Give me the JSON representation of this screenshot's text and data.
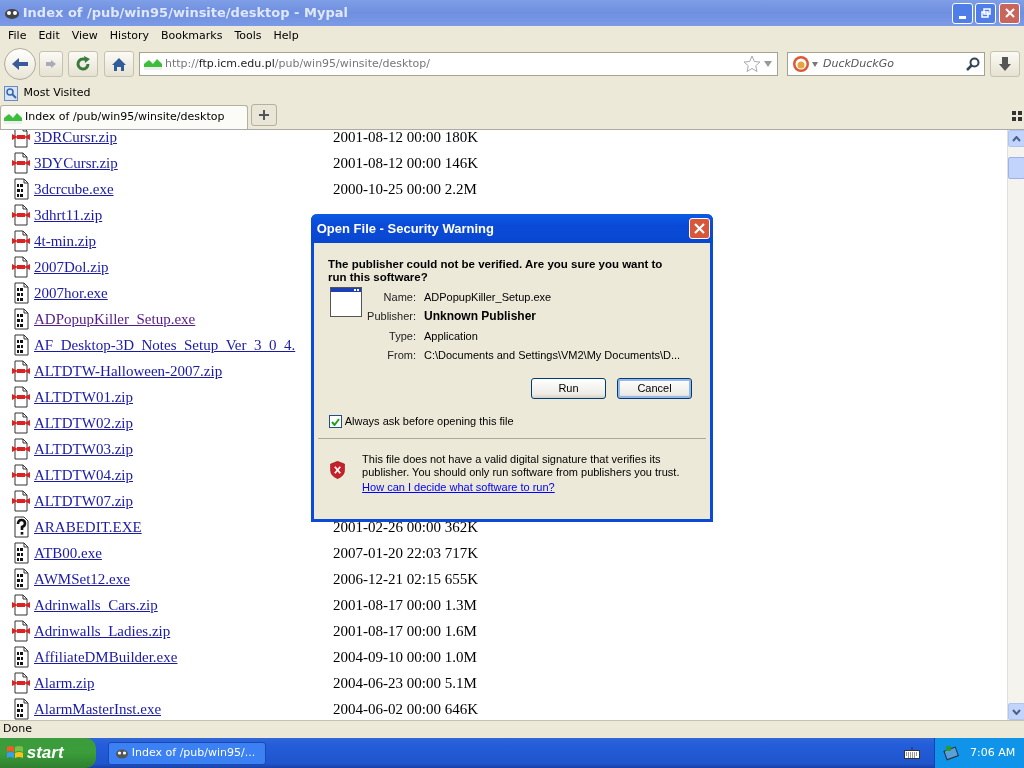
{
  "window": {
    "title": "Index of /pub/win95/winsite/desktop - Mypal"
  },
  "menu": [
    "File",
    "Edit",
    "View",
    "History",
    "Bookmarks",
    "Tools",
    "Help"
  ],
  "address": {
    "prefix": "http://",
    "host": "ftp.icm.edu.pl",
    "path": "/pub/win95/winsite/desktop/"
  },
  "search": {
    "placeholder": "DuckDuckGo"
  },
  "bookmarks": [
    {
      "label": "Most Visited"
    }
  ],
  "tabs": [
    {
      "label": "Index of /pub/win95/winsite/desktop",
      "selected": true
    }
  ],
  "files": [
    {
      "kind": "zip",
      "name": "3DRCursr.zip",
      "meta": "2001-08-12 00:00 180K",
      "visited": false
    },
    {
      "kind": "zip",
      "name": "3DYCursr.zip",
      "meta": "2001-08-12 00:00 146K",
      "visited": false
    },
    {
      "kind": "exe",
      "name": "3dcrcube.exe",
      "meta": "2000-10-25 00:00 2.2M",
      "visited": false
    },
    {
      "kind": "zip",
      "name": "3dhrt11.zip",
      "visited": false
    },
    {
      "kind": "zip",
      "name": "4t-min.zip",
      "visited": false
    },
    {
      "kind": "zip",
      "name": "2007Dol.zip",
      "visited": false
    },
    {
      "kind": "exe",
      "name": "2007hor.exe",
      "visited": false
    },
    {
      "kind": "exe",
      "name": "ADPopupKiller_Setup.exe",
      "visited": true
    },
    {
      "kind": "exe",
      "name": "AF_Desktop-3D_Notes_Setup_Ver_3_0_4.",
      "visited": false
    },
    {
      "kind": "zip",
      "name": "ALTDTW-Halloween-2007.zip",
      "visited": false
    },
    {
      "kind": "zip",
      "name": "ALTDTW01.zip",
      "visited": false
    },
    {
      "kind": "zip",
      "name": "ALTDTW02.zip",
      "visited": false
    },
    {
      "kind": "zip",
      "name": "ALTDTW03.zip",
      "visited": false
    },
    {
      "kind": "zip",
      "name": "ALTDTW04.zip",
      "visited": false
    },
    {
      "kind": "zip",
      "name": "ALTDTW07.zip",
      "visited": false
    },
    {
      "kind": "unknown",
      "name": "ARABEDIT.EXE",
      "meta": "2001-02-26 00:00 362K",
      "visited": false
    },
    {
      "kind": "exe",
      "name": "ATB00.exe",
      "meta": "2007-01-20 22:03 717K",
      "visited": false
    },
    {
      "kind": "exe",
      "name": "AWMSet12.exe",
      "meta": "2006-12-21 02:15 655K",
      "visited": false
    },
    {
      "kind": "zip",
      "name": "Adrinwalls_Cars.zip",
      "meta": "2001-08-17 00:00 1.3M",
      "visited": false
    },
    {
      "kind": "zip",
      "name": "Adrinwalls_Ladies.zip",
      "meta": "2001-08-17 00:00 1.6M",
      "visited": false
    },
    {
      "kind": "exe",
      "name": "AffiliateDMBuilder.exe",
      "meta": "2004-09-10 00:00 1.0M",
      "visited": false
    },
    {
      "kind": "zip",
      "name": "Alarm.zip",
      "meta": "2004-06-23 00:00 5.1M",
      "visited": false
    },
    {
      "kind": "exe",
      "name": "AlarmMasterInst.exe",
      "meta": "2004-06-02 00:00 646K",
      "visited": false
    }
  ],
  "dialog": {
    "title": "Open File - Security Warning",
    "heading": "The publisher could not be verified.  Are you sure you want to run this software?",
    "fields": [
      {
        "label": "Name:",
        "value": "ADPopupKiller_Setup.exe",
        "emphasis": false
      },
      {
        "label": "Publisher:",
        "value": "Unknown Publisher",
        "emphasis": true
      },
      {
        "label": "Type:",
        "value": "Application",
        "emphasis": false
      },
      {
        "label": "From:",
        "value": "C:\\Documents and Settings\\VM2\\My Documents\\D...",
        "emphasis": false
      }
    ],
    "buttons": [
      {
        "label": "Run",
        "focused": false
      },
      {
        "label": "Cancel",
        "focused": true
      }
    ],
    "checkbox": {
      "label": "Always ask before opening this file",
      "checked": true
    },
    "warning": {
      "text": "This file does not have a valid digital signature that verifies its publisher.  You should only run software from publishers you trust.",
      "link": "How can I decide what software to run?"
    }
  },
  "status_bar": "Done",
  "taskbar": {
    "start": "start",
    "tasks": [
      {
        "label": "Index of /pub/win95/..."
      }
    ],
    "clock": "7:06 AM"
  }
}
